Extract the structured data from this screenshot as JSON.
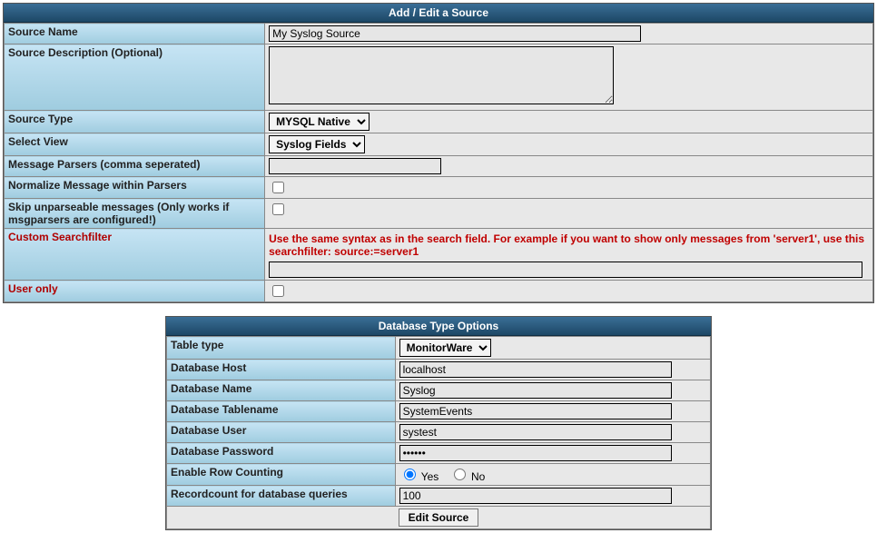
{
  "panel1": {
    "title": "Add / Edit a Source",
    "rows": {
      "sourceName": {
        "label": "Source Name",
        "value": "My Syslog Source"
      },
      "sourceDesc": {
        "label": "Source Description (Optional)",
        "value": ""
      },
      "sourceType": {
        "label": "Source Type",
        "value": "MYSQL Native"
      },
      "selectView": {
        "label": "Select View",
        "value": "Syslog Fields"
      },
      "msgParsers": {
        "label": "Message Parsers (comma seperated)",
        "value": ""
      },
      "normalize": {
        "label": "Normalize Message within Parsers"
      },
      "skipUnparse": {
        "label": "Skip unparseable messages (Only works if msgparsers are configured!)"
      },
      "customFilter": {
        "label": "Custom Searchfilter",
        "hint": "Use the same syntax as in the search field. For example if you want to show only messages from 'server1', use this searchfilter: source:=server1",
        "value": ""
      },
      "userOnly": {
        "label": "User only"
      }
    }
  },
  "panel2": {
    "title": "Database Type Options",
    "rows": {
      "tableType": {
        "label": "Table type",
        "value": "MonitorWare"
      },
      "dbHost": {
        "label": "Database Host",
        "value": "localhost"
      },
      "dbName": {
        "label": "Database Name",
        "value": "Syslog"
      },
      "dbTable": {
        "label": "Database Tablename",
        "value": "SystemEvents"
      },
      "dbUser": {
        "label": "Database User",
        "value": "systest"
      },
      "dbPass": {
        "label": "Database Password",
        "value": "••••••"
      },
      "rowCount": {
        "label": "Enable Row Counting",
        "yes": "Yes",
        "no": "No"
      },
      "recCount": {
        "label": "Recordcount for database queries",
        "value": "100"
      }
    },
    "button": "Edit Source"
  }
}
